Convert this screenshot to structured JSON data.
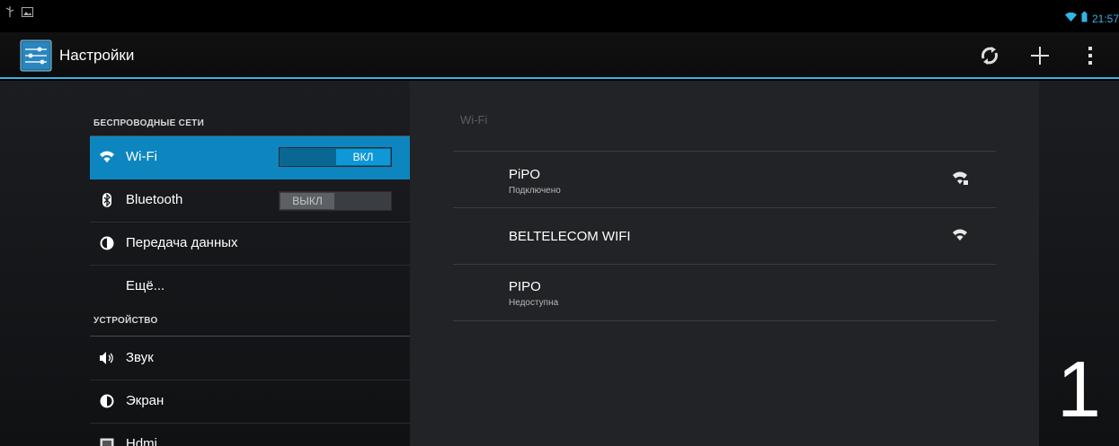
{
  "status_bar": {
    "time": "21:57",
    "icons": [
      "usb-icon",
      "image-icon",
      "wifi-icon",
      "battery-icon"
    ]
  },
  "action_bar": {
    "title": "Настройки",
    "actions": [
      "sync-icon",
      "add-icon",
      "overflow-menu-icon"
    ]
  },
  "left_panel": {
    "sections": [
      {
        "header": "БЕСПРОВОДНЫЕ СЕТИ"
      },
      {
        "header": "УСТРОЙСТВО"
      }
    ],
    "items": [
      {
        "label": "Wi-Fi",
        "icon": "wifi-icon",
        "toggle": "ВКЛ",
        "selected": true
      },
      {
        "label": "Bluetooth",
        "icon": "bluetooth-icon",
        "toggle": "ВЫКЛ"
      },
      {
        "label": "Передача данных",
        "icon": "data-usage-icon"
      },
      {
        "label": "Ещё...",
        "icon": null
      },
      {
        "label": "Звук",
        "icon": "volume-icon"
      },
      {
        "label": "Экран",
        "icon": "display-icon"
      },
      {
        "label": "Hdmi",
        "icon": "hdmi-icon"
      }
    ]
  },
  "wifi_pane": {
    "title": "Wi-Fi",
    "networks": [
      {
        "name": "PiPO",
        "status": "Подключено",
        "signal": "wifi-locked-icon"
      },
      {
        "name": "BELTELECOM WIFI",
        "status": "",
        "signal": "wifi-icon"
      },
      {
        "name": "PIPO",
        "status": "Недоступна",
        "signal": ""
      }
    ]
  },
  "overlay_number": "1",
  "colors": {
    "accent": "#33b5e5",
    "selected_row": "#0d86c0",
    "background": "#101113"
  }
}
